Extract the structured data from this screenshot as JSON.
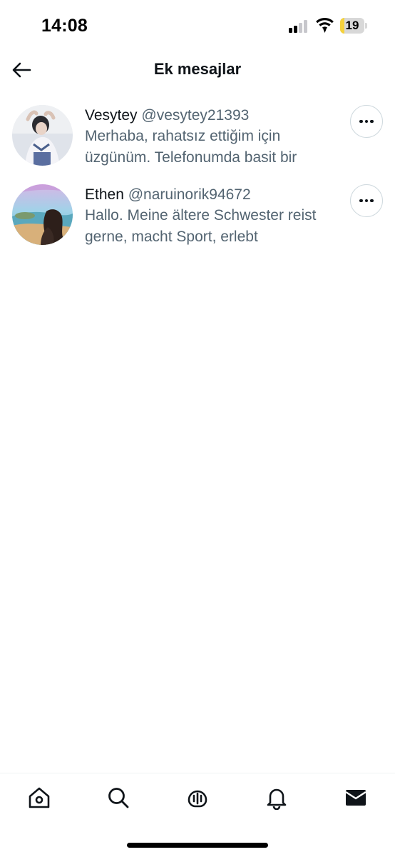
{
  "status_bar": {
    "time": "14:08",
    "battery_level": "19",
    "battery_color": "#f5d23c"
  },
  "header": {
    "title": "Ek mesajlar"
  },
  "requests": [
    {
      "display_name": "Vesytey",
      "handle": "@vesytey21393",
      "preview": "Merhaba, rahatsız ettiğim için üzgünüm. Telefonumda basit bir"
    },
    {
      "display_name": "Ethen",
      "handle": "@naruinorik94672",
      "preview": "Hallo. Meine ältere Schwester reist gerne, macht Sport, erlebt"
    }
  ],
  "bottom_nav": {
    "items": [
      "home-icon",
      "search-icon",
      "spaces-icon",
      "notifications-icon",
      "messages-icon"
    ],
    "active": "messages-icon"
  },
  "colors": {
    "primary_text": "#0f1419",
    "secondary_text": "#536471",
    "border": "#cfd9de"
  }
}
